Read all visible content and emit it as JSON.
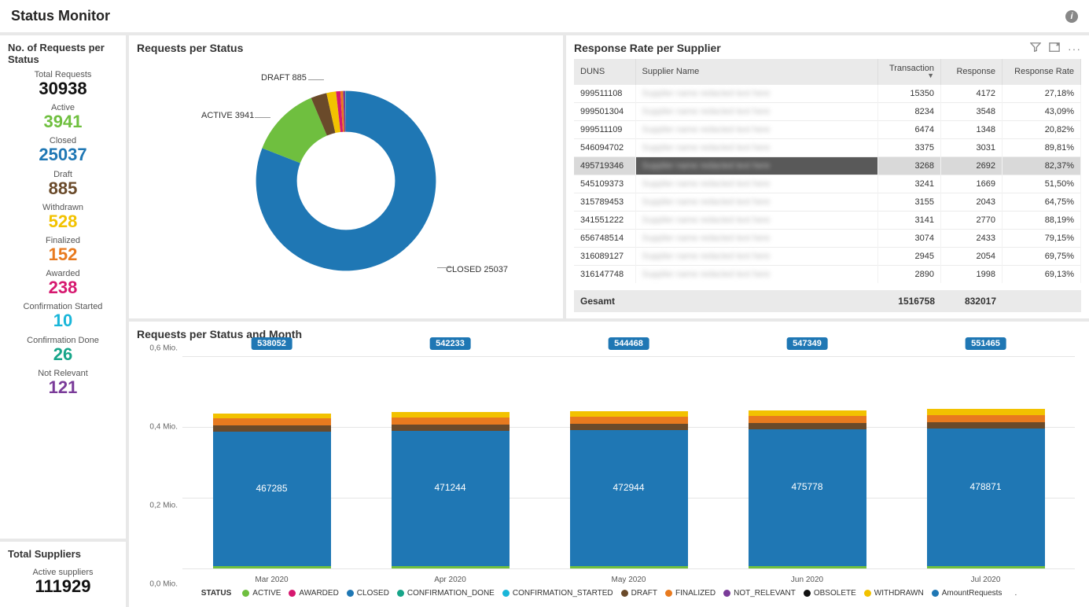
{
  "header": {
    "title": "Status Monitor"
  },
  "kpi": {
    "panel_title": "No. of Requests per Status",
    "items": [
      {
        "label": "Total Requests",
        "value": "30938",
        "color": "#111"
      },
      {
        "label": "Active",
        "value": "3941",
        "color": "#6fbf3f"
      },
      {
        "label": "Closed",
        "value": "25037",
        "color": "#1f77b4"
      },
      {
        "label": "Draft",
        "value": "885",
        "color": "#6a4a2a"
      },
      {
        "label": "Withdrawn",
        "value": "528",
        "color": "#f2c200"
      },
      {
        "label": "Finalized",
        "value": "152",
        "color": "#e87a1f"
      },
      {
        "label": "Awarded",
        "value": "238",
        "color": "#d6186f"
      },
      {
        "label": "Confirmation Started",
        "value": "10",
        "color": "#19b6d9"
      },
      {
        "label": "Confirmation Done",
        "value": "26",
        "color": "#17a589"
      },
      {
        "label": "Not Relevant",
        "value": "121",
        "color": "#7a3b99"
      }
    ]
  },
  "suppliers": {
    "panel_title": "Total Suppliers",
    "label": "Active suppliers",
    "value": "111929"
  },
  "donut": {
    "title": "Requests per Status",
    "labels": {
      "draft": "DRAFT 885",
      "active": "ACTIVE 3941",
      "closed": "CLOSED 25037"
    }
  },
  "responseTable": {
    "title": "Response Rate per Supplier",
    "columns": {
      "duns": "DUNS",
      "name": "Supplier Name",
      "transaction": "Transaction",
      "response": "Response",
      "rate": "Response Rate"
    },
    "rows": [
      {
        "duns": "999511108",
        "transaction": "15350",
        "response": "4172",
        "rate": "27,18%"
      },
      {
        "duns": "999501304",
        "transaction": "8234",
        "response": "3548",
        "rate": "43,09%"
      },
      {
        "duns": "999511109",
        "transaction": "6474",
        "response": "1348",
        "rate": "20,82%"
      },
      {
        "duns": "546094702",
        "transaction": "3375",
        "response": "3031",
        "rate": "89,81%"
      },
      {
        "duns": "495719346",
        "transaction": "3268",
        "response": "2692",
        "rate": "82,37%",
        "highlight": true
      },
      {
        "duns": "545109373",
        "transaction": "3241",
        "response": "1669",
        "rate": "51,50%"
      },
      {
        "duns": "315789453",
        "transaction": "3155",
        "response": "2043",
        "rate": "64,75%"
      },
      {
        "duns": "341551222",
        "transaction": "3141",
        "response": "2770",
        "rate": "88,19%"
      },
      {
        "duns": "656748514",
        "transaction": "3074",
        "response": "2433",
        "rate": "79,15%"
      },
      {
        "duns": "316089127",
        "transaction": "2945",
        "response": "2054",
        "rate": "69,75%"
      },
      {
        "duns": "316147748",
        "transaction": "2890",
        "response": "1998",
        "rate": "69,13%"
      }
    ],
    "footer": {
      "label": "Gesamt",
      "transaction": "1516758",
      "response": "832017"
    }
  },
  "barChart": {
    "title": "Requests per Status and Month",
    "y_ticks": [
      "0,0 Mio.",
      "0,2 Mio.",
      "0,4 Mio.",
      "0,6 Mio."
    ],
    "ymax": 600000,
    "categories": [
      "Mar 2020",
      "Apr 2020",
      "May 2020",
      "Jun 2020",
      "Jul 2020"
    ],
    "totals": [
      "538052",
      "542233",
      "544468",
      "547349",
      "551465"
    ],
    "closed": [
      "467285",
      "471244",
      "472944",
      "475778",
      "478871"
    ],
    "legend_title": "STATUS",
    "legend": [
      {
        "name": "ACTIVE",
        "color": "#6fbf3f"
      },
      {
        "name": "AWARDED",
        "color": "#d6186f"
      },
      {
        "name": "CLOSED",
        "color": "#1f77b4"
      },
      {
        "name": "CONFIRMATION_DONE",
        "color": "#17a589"
      },
      {
        "name": "CONFIRMATION_STARTED",
        "color": "#19b6d9"
      },
      {
        "name": "DRAFT",
        "color": "#6a4a2a"
      },
      {
        "name": "FINALIZED",
        "color": "#e87a1f"
      },
      {
        "name": "NOT_RELEVANT",
        "color": "#7a3b99"
      },
      {
        "name": "OBSOLETE",
        "color": "#111"
      },
      {
        "name": "WITHDRAWN",
        "color": "#f2c200"
      },
      {
        "name": "AmountRequests",
        "color": "#1f77b4"
      }
    ]
  },
  "chart_data": [
    {
      "type": "pie",
      "title": "Requests per Status",
      "series": [
        {
          "name": "CLOSED",
          "value": 25037,
          "color": "#1f77b4"
        },
        {
          "name": "ACTIVE",
          "value": 3941,
          "color": "#6fbf3f"
        },
        {
          "name": "DRAFT",
          "value": 885,
          "color": "#6a4a2a"
        },
        {
          "name": "WITHDRAWN",
          "value": 528,
          "color": "#f2c200"
        },
        {
          "name": "AWARDED",
          "value": 238,
          "color": "#d6186f"
        },
        {
          "name": "FINALIZED",
          "value": 152,
          "color": "#e87a1f"
        },
        {
          "name": "NOT_RELEVANT",
          "value": 121,
          "color": "#7a3b99"
        },
        {
          "name": "CONFIRMATION_DONE",
          "value": 26,
          "color": "#17a589"
        },
        {
          "name": "CONFIRMATION_STARTED",
          "value": 10,
          "color": "#19b6d9"
        }
      ]
    },
    {
      "type": "bar",
      "title": "Requests per Status and Month",
      "stacked": true,
      "xlabel": "",
      "ylabel": "",
      "ylim": [
        0,
        600000
      ],
      "categories": [
        "Mar 2020",
        "Apr 2020",
        "May 2020",
        "Jun 2020",
        "Jul 2020"
      ],
      "series": [
        {
          "name": "ACTIVE",
          "color": "#6fbf3f",
          "values": [
            7000,
            7000,
            7000,
            7000,
            7000
          ]
        },
        {
          "name": "CLOSED",
          "color": "#1f77b4",
          "values": [
            467285,
            471244,
            472944,
            475778,
            478871
          ]
        },
        {
          "name": "DRAFT",
          "color": "#6a4a2a",
          "values": [
            22000,
            22000,
            22000,
            22000,
            22000
          ]
        },
        {
          "name": "FINALIZED",
          "color": "#e87a1f",
          "values": [
            24000,
            24000,
            24000,
            24000,
            24000
          ]
        },
        {
          "name": "WITHDRAWN",
          "color": "#f2c200",
          "values": [
            17767,
            17989,
            20524,
            20571,
            22594
          ]
        }
      ],
      "totals": [
        538052,
        542233,
        544468,
        547349,
        551465
      ]
    }
  ]
}
